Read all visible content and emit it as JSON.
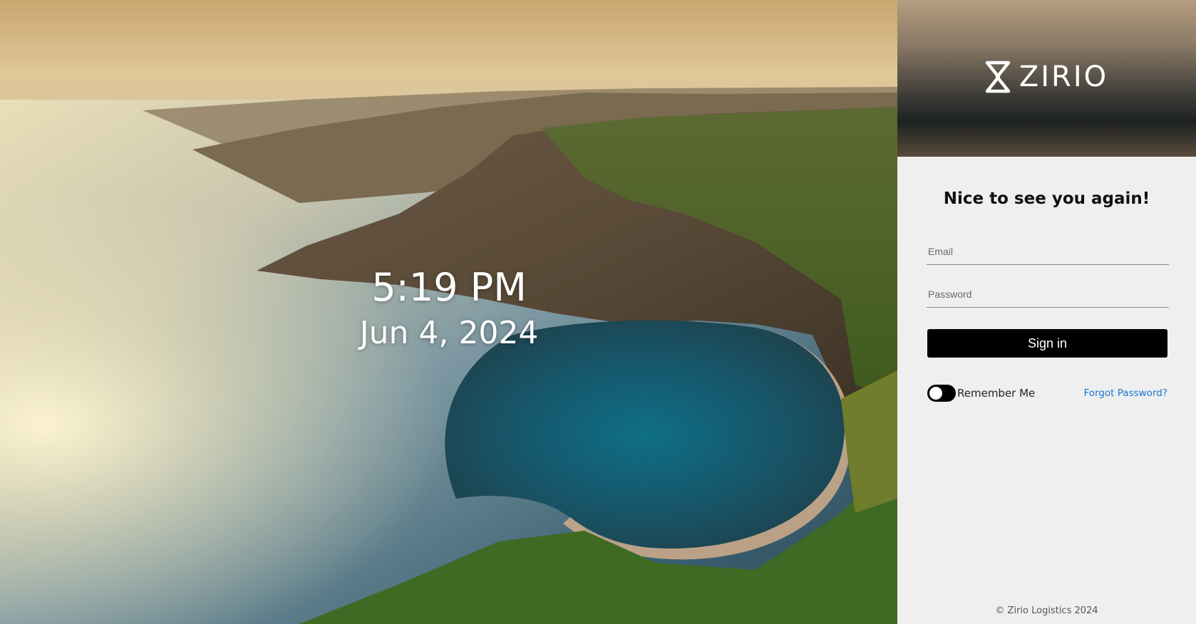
{
  "clock": {
    "time": "5:19 PM",
    "date": "Jun 4, 2024"
  },
  "brand": {
    "name": "ZIRIO"
  },
  "login": {
    "heading": "Nice to see you again!",
    "email_placeholder": "Email",
    "password_placeholder": "Password",
    "signin_label": "Sign in",
    "remember_label": "Remember Me",
    "remember_on": false,
    "forgot_label": "Forgot Password?"
  },
  "footer": {
    "text": "© Zirio Logistics 2024"
  },
  "colors": {
    "link": "#1677d2",
    "button": "#000000",
    "panel_bg": "#efefef"
  }
}
